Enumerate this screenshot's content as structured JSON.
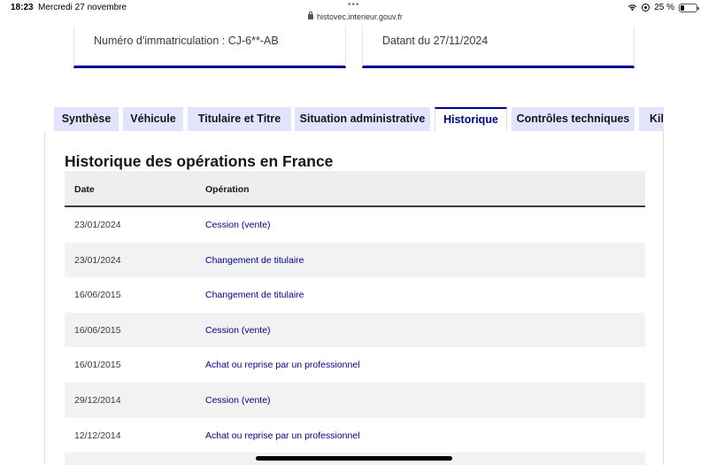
{
  "status_bar": {
    "time": "18:23",
    "date": "Mercredi 27 novembre",
    "url": "histovec.interieur.gouv.fr",
    "battery": "25 %",
    "battery_level": 0.25
  },
  "cards": {
    "registration": "Numéro d'immatriculation : CJ-6**-AB",
    "date": "Datant du 27/11/2024"
  },
  "tabs": [
    {
      "label": "Synthèse",
      "active": false
    },
    {
      "label": "Véhicule",
      "active": false
    },
    {
      "label": "Titulaire et Titre",
      "active": false
    },
    {
      "label": "Situation administrative",
      "active": false
    },
    {
      "label": "Historique",
      "active": true
    },
    {
      "label": "Contrôles techniques",
      "active": false
    },
    {
      "label": "Kilométrage",
      "active": false
    }
  ],
  "history": {
    "title": "Historique des opérations en France",
    "columns": {
      "date": "Date",
      "operation": "Opération"
    },
    "rows": [
      {
        "date": "23/01/2024",
        "operation": "Cession (vente)"
      },
      {
        "date": "23/01/2024",
        "operation": "Changement de titulaire"
      },
      {
        "date": "16/06/2015",
        "operation": "Changement de titulaire"
      },
      {
        "date": "16/06/2015",
        "operation": "Cession (vente)"
      },
      {
        "date": "16/01/2015",
        "operation": "Achat ou reprise par un professionnel"
      },
      {
        "date": "29/12/2014",
        "operation": "Cession (vente)"
      },
      {
        "date": "12/12/2014",
        "operation": "Achat ou reprise par un professionnel"
      },
      {
        "date": "",
        "operation": ""
      }
    ]
  },
  "colors": {
    "brand_blue": "#000091",
    "tab_bg": "#e3e3fd",
    "row_alt": "#f2f2f2"
  }
}
